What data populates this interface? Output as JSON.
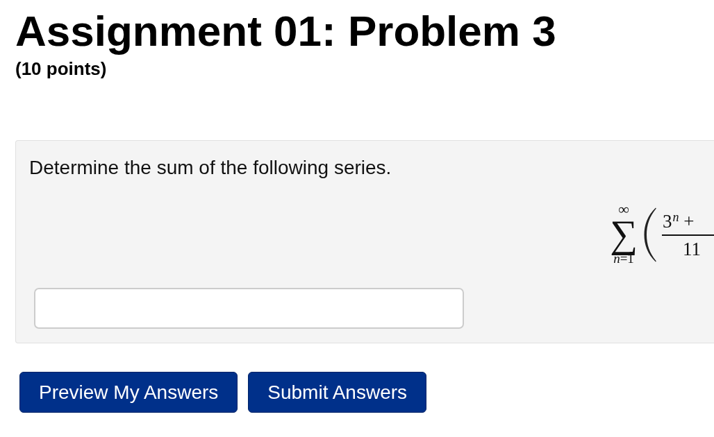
{
  "page": {
    "title": "Assignment 01: Problem 3",
    "points": "(10 points)"
  },
  "problem": {
    "prompt": "Determine the sum of the following series.",
    "formula": {
      "operator": "∑",
      "upper_limit": "∞",
      "lower_limit": "*n*=1",
      "numerator": "3$^{n}$ +",
      "denominator": "11"
    }
  },
  "buttons": [
    {
      "label": "Preview My Answers"
    },
    {
      "label": "Submit Answers"
    }
  ]
}
